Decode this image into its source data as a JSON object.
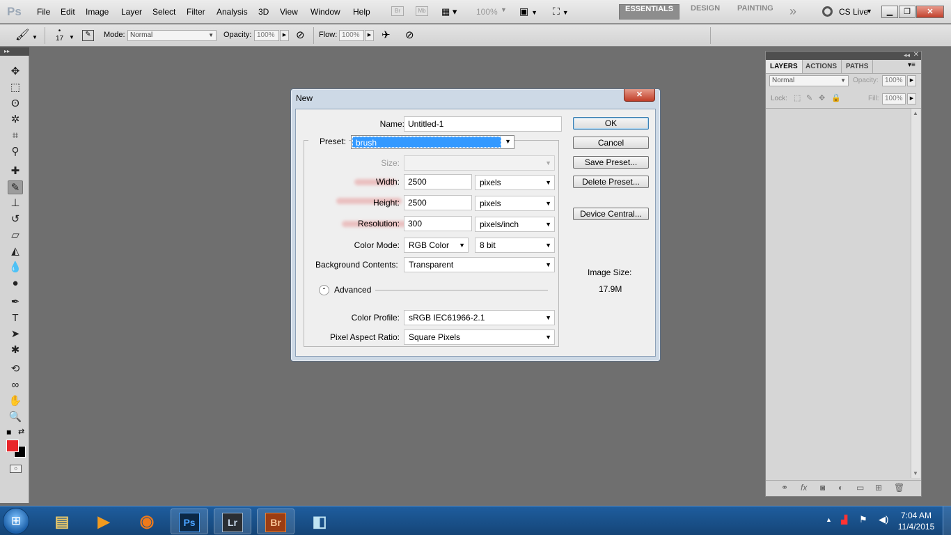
{
  "app": {
    "logo": "Ps"
  },
  "menubar": {
    "items": [
      "File",
      "Edit",
      "Image",
      "Layer",
      "Select",
      "Filter",
      "Analysis",
      "3D",
      "View",
      "Window",
      "Help"
    ],
    "zoom": "100%",
    "bridge_icon": "Br",
    "minibridge_icon": "Mb",
    "workspaces": [
      "ESSENTIALS",
      "DESIGN",
      "PAINTING"
    ],
    "more": "»",
    "cslive": "CS Live"
  },
  "options": {
    "brush_size": "17",
    "mode_label": "Mode:",
    "mode_value": "Normal",
    "opacity_label": "Opacity:",
    "opacity_value": "100%",
    "flow_label": "Flow:",
    "flow_value": "100%"
  },
  "layers_panel": {
    "tabs": [
      "LAYERS",
      "ACTIONS",
      "PATHS"
    ],
    "blend_mode": "Normal",
    "opacity_label": "Opacity:",
    "opacity_value": "100%",
    "lock_label": "Lock:",
    "fill_label": "Fill:",
    "fill_value": "100%"
  },
  "dialog": {
    "title": "New",
    "name_label": "Name:",
    "name_value": "Untitled-1",
    "preset_label": "Preset:",
    "preset_value": "brush",
    "size_label": "Size:",
    "width_label": "Width:",
    "width_value": "2500",
    "width_unit": "pixels",
    "height_label": "Height:",
    "height_value": "2500",
    "height_unit": "pixels",
    "resolution_label": "Resolution:",
    "resolution_value": "300",
    "resolution_unit": "pixels/inch",
    "color_mode_label": "Color Mode:",
    "color_mode_value": "RGB Color",
    "bit_depth_value": "8 bit",
    "background_label": "Background Contents:",
    "background_value": "Transparent",
    "advanced_label": "Advanced",
    "color_profile_label": "Color Profile:",
    "color_profile_value": "sRGB IEC61966-2.1",
    "pixel_aspect_label": "Pixel Aspect Ratio:",
    "pixel_aspect_value": "Square Pixels",
    "buttons": {
      "ok": "OK",
      "cancel": "Cancel",
      "save_preset": "Save Preset...",
      "delete_preset": "Delete Preset...",
      "device_central": "Device Central..."
    },
    "image_size_label": "Image Size:",
    "image_size_value": "17.9M"
  },
  "taskbar": {
    "apps": [
      "Ps",
      "Lr",
      "Br"
    ],
    "time": "7:04 AM",
    "date": "11/4/2015"
  },
  "colors": {
    "foreground": "#e8262a",
    "background": "#000000",
    "accent": "#3399ff"
  }
}
